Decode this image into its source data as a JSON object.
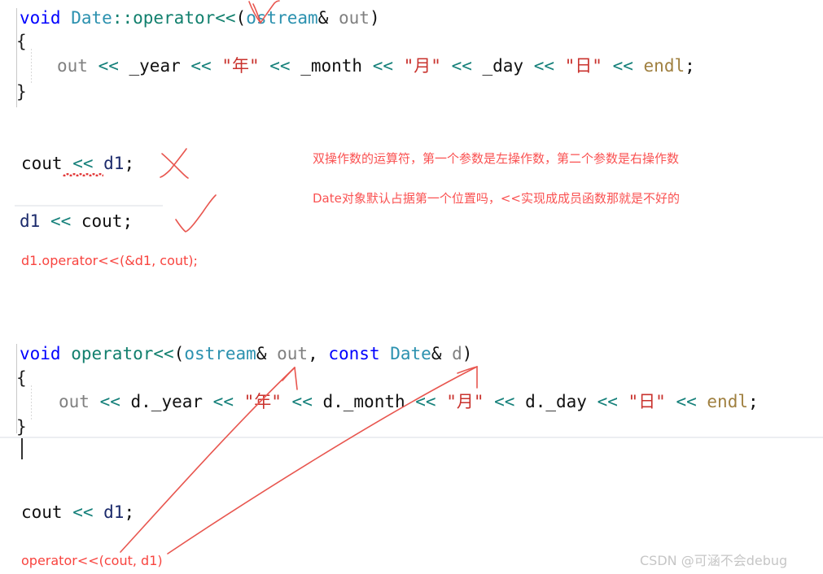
{
  "editor": {
    "block1": {
      "line1": {
        "kw": "void",
        "sp1": " ",
        "type": "Date",
        "scope": "::operator<<",
        "paren_open": "(",
        "param_type": "ostream",
        "amp": "&",
        "param_name": " out",
        "paren_close": ")"
      },
      "line2": {
        "brace": "{"
      },
      "line3": {
        "out": "out",
        "op1": " << ",
        "year": "_year",
        "op2": " << ",
        "s_year": "\"年\"",
        "op3": " << ",
        "month": "_month",
        "op4": " << ",
        "s_month": "\"月\"",
        "op5": " << ",
        "day": "_day",
        "op6": " << ",
        "s_day": "\"日\"",
        "op7": " << ",
        "endl": "endl",
        "semi": ";"
      },
      "line4": {
        "brace": "}"
      }
    },
    "snippet_bad": {
      "cout": "cout",
      "op": " << ",
      "d1": "d1",
      "semi": ";"
    },
    "snippet_good": {
      "d1": "d1",
      "op": " << ",
      "cout": "cout",
      "semi": ";"
    },
    "block2": {
      "line1": {
        "kw": "void",
        "sp1": " ",
        "fn": "operator<<",
        "paren_open": "(",
        "p1_type": "ostream",
        "amp1": "&",
        "p1_name": " out",
        "comma": ", ",
        "kw2": "const",
        "sp2": " ",
        "p2_type": "Date",
        "amp2": "&",
        "p2_name": " d",
        "paren_close": ")"
      },
      "line2": {
        "brace": "{"
      },
      "line3": {
        "out": "out",
        "op1": " << ",
        "year": "d._year",
        "op2": " << ",
        "s_year": "\"年\"",
        "op3": " << ",
        "month": "d._month",
        "op4": " << ",
        "s_month": "\"月\"",
        "op5": " << ",
        "day": "d._day",
        "op6": " << ",
        "s_day": "\"日\"",
        "op7": " << ",
        "endl": "endl",
        "semi": ";"
      },
      "line4": {
        "brace": "}"
      }
    },
    "snippet_call": {
      "cout": "cout",
      "op": " << ",
      "d1": "d1",
      "semi": ";"
    }
  },
  "annotations": {
    "note_member_call": "d1.operator<<(&d1, cout);",
    "note_global_call": "operator<<(cout, d1)",
    "note_cn_1": "双操作数的运算符，第一个参数是左操作数，第二个参数是右操作数",
    "note_cn_2": "Date对象默认占据第一个位置吗，<<实现成成员函数那就是不好的"
  },
  "watermark": {
    "text": "CSDN @可涵不会debug"
  },
  "colors": {
    "keyword": "#0000ff",
    "type": "#2b91af",
    "function": "#12806e",
    "operator": "#15807a",
    "variable": "#808080",
    "string": "#c9322d",
    "library": "#a08040",
    "identifier": "#1b2a6b",
    "annotation_red": "#fa5252",
    "ink_red": "#e8564f",
    "watermark_gray": "#c6c6c6",
    "background": "#ffffff"
  }
}
